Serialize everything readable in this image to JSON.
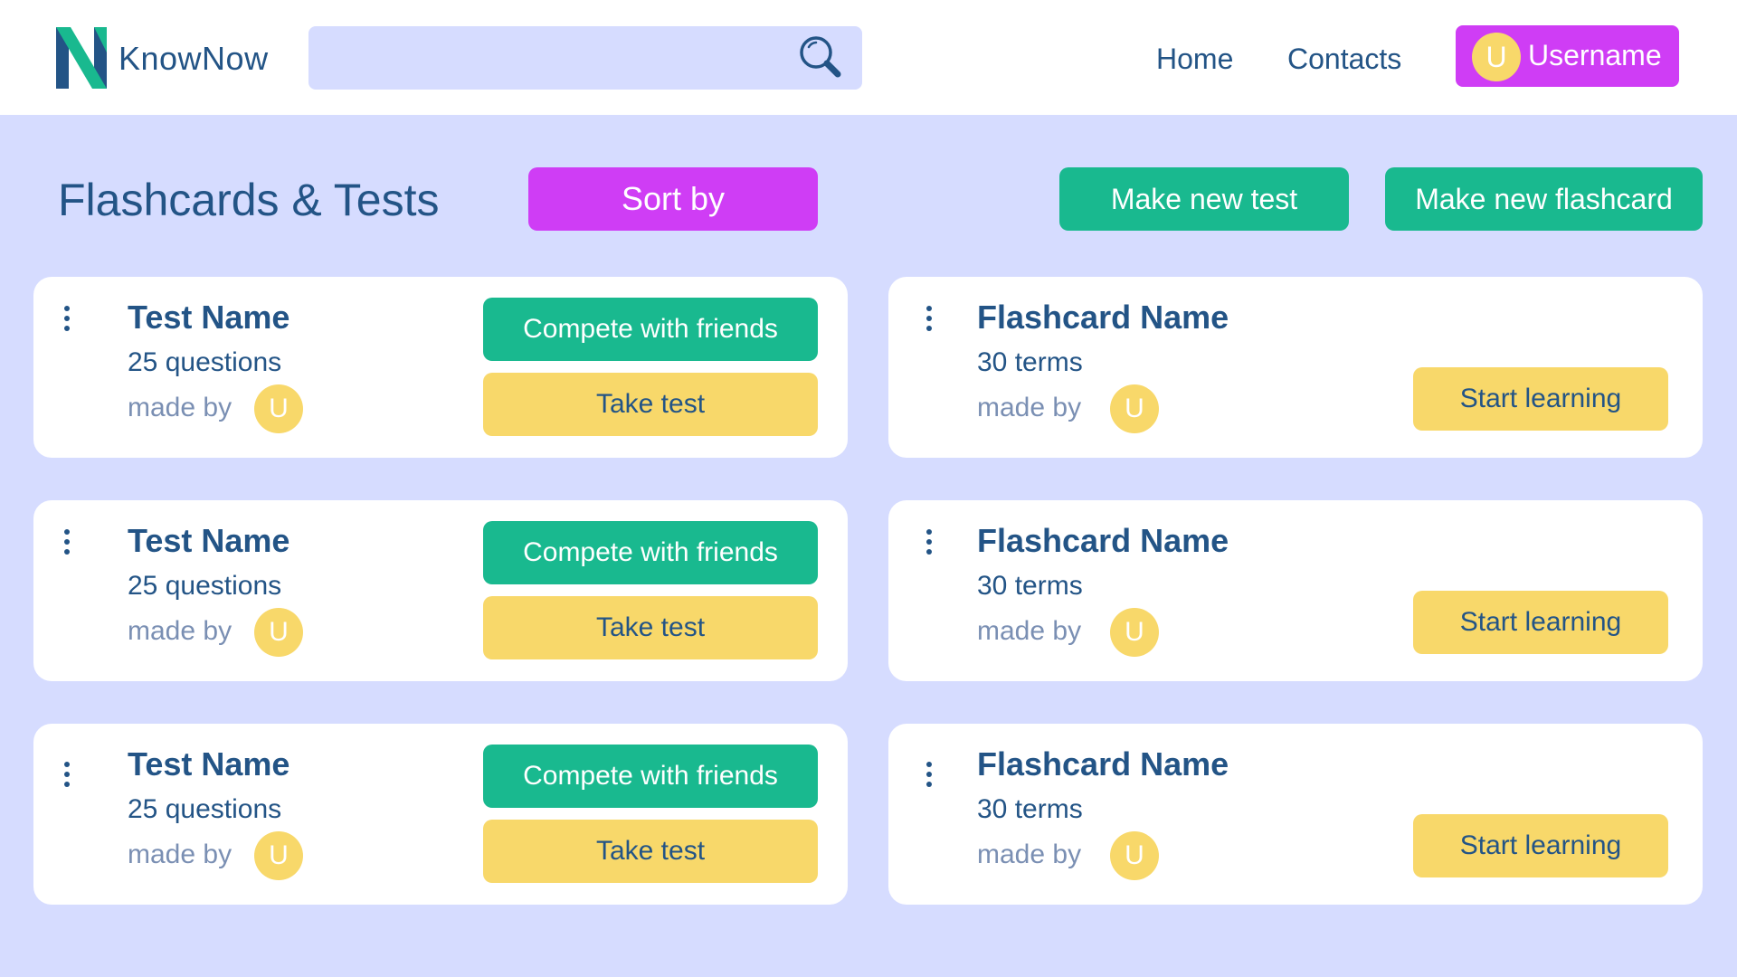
{
  "header": {
    "brand": "KnowNow",
    "search_placeholder": "",
    "nav": {
      "home": "Home",
      "contacts": "Contacts"
    },
    "user": {
      "initial": "U",
      "name": "Username"
    }
  },
  "toolbar": {
    "title": "Flashcards & Tests",
    "sort_label": "Sort by",
    "new_test_label": "Make new test",
    "new_flashcard_label": "Make new flashcard"
  },
  "tests": [
    {
      "name": "Test Name",
      "count": "25 questions",
      "made_by": "made by",
      "author_initial": "U",
      "compete_label": "Compete with friends",
      "take_label": "Take test"
    },
    {
      "name": "Test Name",
      "count": "25 questions",
      "made_by": "made by",
      "author_initial": "U",
      "compete_label": "Compete with friends",
      "take_label": "Take test"
    },
    {
      "name": "Test Name",
      "count": "25 questions",
      "made_by": "made by",
      "author_initial": "U",
      "compete_label": "Compete with friends",
      "take_label": "Take test"
    }
  ],
  "flashcards": [
    {
      "name": "Flashcard Name",
      "count": "30 terms",
      "made_by": "made by",
      "author_initial": "U",
      "start_label": "Start learning"
    },
    {
      "name": "Flashcard Name",
      "count": "30 terms",
      "made_by": "made by",
      "author_initial": "U",
      "start_label": "Start learning"
    },
    {
      "name": "Flashcard Name",
      "count": "30 terms",
      "made_by": "made by",
      "author_initial": "U",
      "start_label": "Start learning"
    }
  ],
  "colors": {
    "background": "#d6dcff",
    "primary_text": "#235486",
    "accent_purple": "#cf3df5",
    "accent_green": "#19b98f",
    "accent_yellow": "#f8d86a"
  },
  "icons": {
    "logo": "knownow-logo",
    "search": "search-icon",
    "menu": "kebab-menu-icon"
  }
}
